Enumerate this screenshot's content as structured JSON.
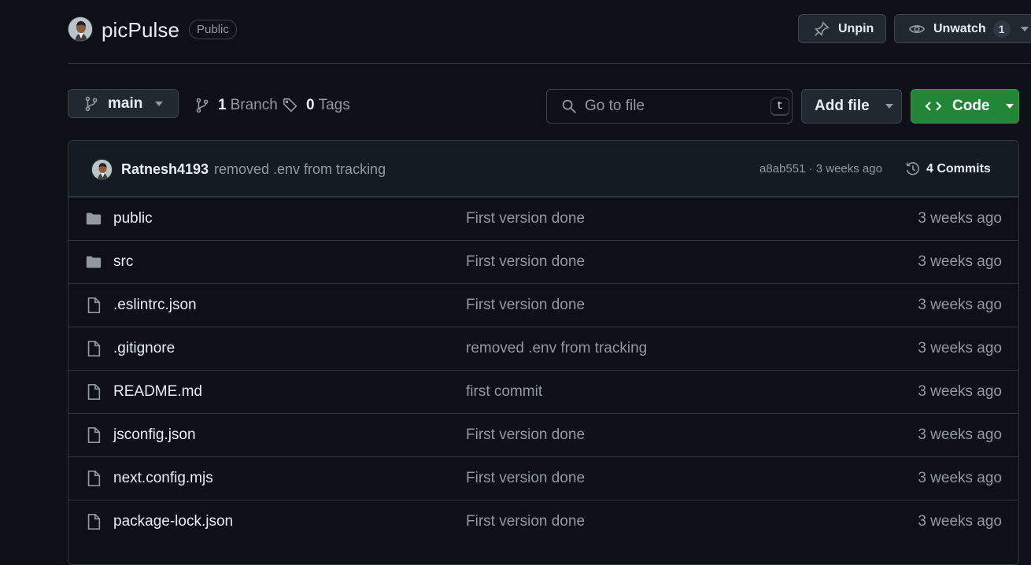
{
  "repository": {
    "name": "picPulse",
    "visibility": "Public",
    "actions": {
      "unpin_label": "Unpin",
      "unwatch_label": "Unwatch",
      "watch_count": "1"
    }
  },
  "toolbar": {
    "branch": "main",
    "branch_count": "1",
    "branch_label": "Branch",
    "tag_count": "0",
    "tags_label": "Tags",
    "search_placeholder": "Go to file",
    "search_shortcut": "t",
    "add_file_label": "Add file",
    "code_label": "Code"
  },
  "latest_commit": {
    "author": "Ratnesh4193",
    "message": "removed .env from tracking",
    "hash_and_time": "a8ab551 · 3 weeks ago",
    "commits_label": "4 Commits"
  },
  "files": [
    {
      "type": "folder",
      "icon": "folder-icon",
      "name": "public",
      "message": "First version done",
      "time": "3 weeks ago"
    },
    {
      "type": "folder",
      "icon": "folder-icon",
      "name": "src",
      "message": "First version done",
      "time": "3 weeks ago"
    },
    {
      "type": "file",
      "icon": "file-icon",
      "name": ".eslintrc.json",
      "message": "First version done",
      "time": "3 weeks ago"
    },
    {
      "type": "file",
      "icon": "file-icon",
      "name": ".gitignore",
      "message": "removed .env from tracking",
      "time": "3 weeks ago"
    },
    {
      "type": "file",
      "icon": "file-icon",
      "name": "README.md",
      "message": "first commit",
      "time": "3 weeks ago"
    },
    {
      "type": "file",
      "icon": "file-icon",
      "name": "jsconfig.json",
      "message": "First version done",
      "time": "3 weeks ago"
    },
    {
      "type": "file",
      "icon": "file-icon",
      "name": "next.config.mjs",
      "message": "First version done",
      "time": "3 weeks ago"
    },
    {
      "type": "file",
      "icon": "file-icon",
      "name": "package-lock.json",
      "message": "First version done",
      "time": "3 weeks ago"
    }
  ],
  "theme": {
    "background": "#0d1117",
    "accent": "#238636",
    "text_primary": "#e6edf3",
    "text_muted": "#9198a1"
  }
}
